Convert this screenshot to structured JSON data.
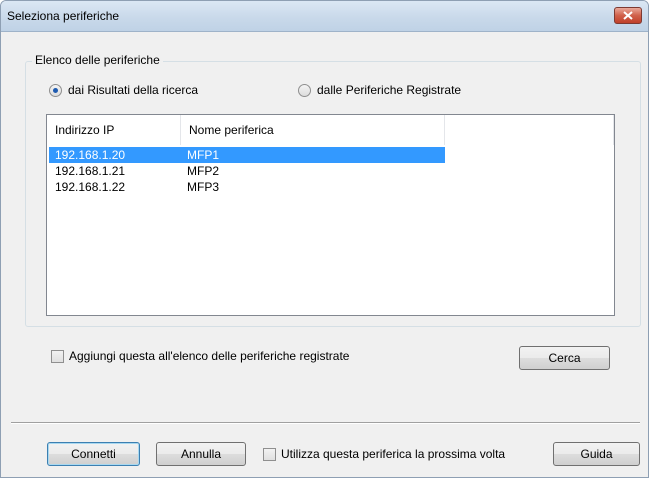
{
  "window": {
    "title": "Seleziona periferiche"
  },
  "group": {
    "label": "Elenco delle periferiche",
    "radio_search": "dai Risultati della ricerca",
    "radio_registered": "dalle Periferiche Registrate",
    "selected_radio": "radio_search"
  },
  "device_list": {
    "columns": [
      "Indirizzo IP",
      "Nome periferica"
    ],
    "rows": [
      {
        "ip": "192.168.1.20",
        "name": "MFP1",
        "selected": true
      },
      {
        "ip": "192.168.1.21",
        "name": "MFP2",
        "selected": false
      },
      {
        "ip": "192.168.1.22",
        "name": "MFP3",
        "selected": false
      }
    ]
  },
  "add_to_registered": {
    "label": "Aggiungi questa all'elenco delle periferiche registrate",
    "checked": false
  },
  "search_button": "Cerca",
  "footer": {
    "connect": "Connetti",
    "cancel": "Annulla",
    "use_next_time": {
      "label": "Utilizza questa periferica la prossima volta",
      "checked": false
    },
    "help": "Guida"
  },
  "colors": {
    "selection": "#3399ff",
    "close": "#c0402a"
  }
}
